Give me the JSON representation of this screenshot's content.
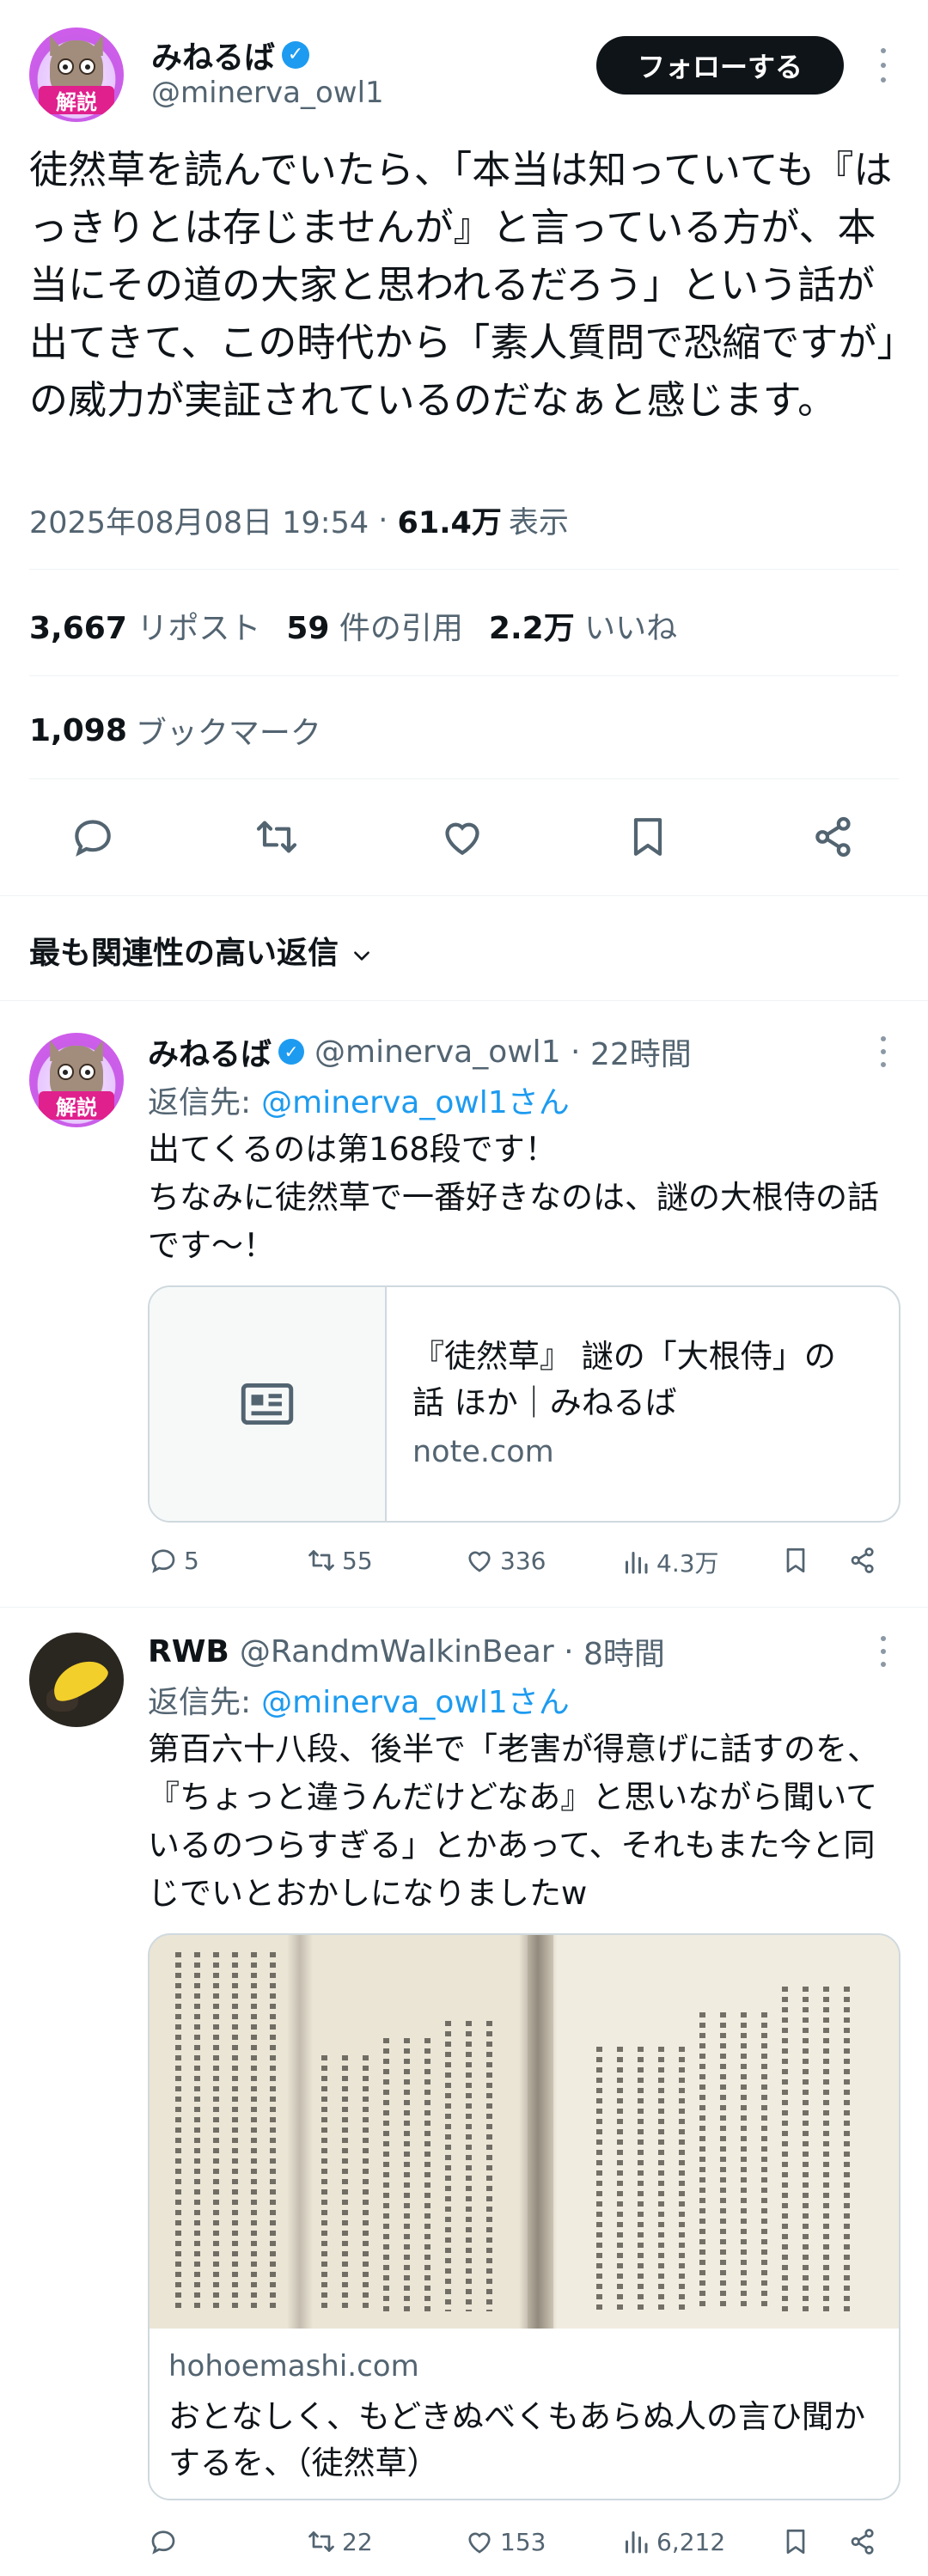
{
  "main_tweet": {
    "display_name": "みねるば",
    "handle": "@minerva_owl1",
    "avatar_tag": "解説",
    "follow_label": "フォローする",
    "text": "徒然草を読んでいたら、「本当は知っていても『はっきりとは存じませんが』と言っている方が、本当にその道の大家と思われるだろう」という話が出てきて、この時代から「素人質問で恐縮ですが」の威力が実証されているのだなぁと感じます。",
    "datetime": "2025年08月08日 19:54",
    "views_count": "61.4万",
    "views_label": "表示"
  },
  "stats": {
    "reposts_count": "3,667",
    "reposts_label": "リポスト",
    "quotes_count": "59",
    "quotes_label": "件の引用",
    "likes_count": "2.2万",
    "likes_label": "いいね",
    "bookmarks_count": "1,098",
    "bookmarks_label": "ブックマーク"
  },
  "action_icons": [
    "reply-icon",
    "repost-icon",
    "like-icon",
    "bookmark-icon",
    "share-icon"
  ],
  "sort": {
    "label": "最も関連性の高い返信"
  },
  "replies": [
    {
      "display_name": "みねるば",
      "handle": "@minerva_owl1",
      "time": "22時間",
      "avatar_tag": "解説",
      "reply_to_prefix": "返信先:",
      "reply_to_handle": "@minerva_owl1さん",
      "text": "出てくるのは第168段です！\nちなみに徒然草で一番好きなのは、謎の大根侍の話です〜！",
      "card": {
        "title": "『徒然草』 謎の「大根侍」の話 ほか｜みねるば",
        "domain": "note.com"
      },
      "replies_count": "5",
      "reposts_count": "55",
      "likes_count": "336",
      "views_count": "4.3万"
    },
    {
      "display_name": "RWB",
      "handle": "@RandmWalkinBear",
      "time": "8時間",
      "reply_to_prefix": "返信先:",
      "reply_to_handle": "@minerva_owl1さん",
      "text": "第百六十八段、後半で「老害が得意げに話すのを、『ちょっと違うんだけどなあ』と思いながら聞いているのつらすぎる」とかあって、それもまた今と同じでいとおかしになりましたw",
      "card": {
        "domain": "hohoemashi.com",
        "title": "おとなしく、もどきぬべくもあらぬ人の言ひ聞かするを、（徒然草）"
      },
      "replies_count": "",
      "reposts_count": "22",
      "likes_count": "153",
      "views_count": "6,212"
    }
  ],
  "colors": {
    "accent": "#1d9bf0",
    "text": "#0f1419",
    "muted": "#536471",
    "divider": "#eff3f4"
  }
}
